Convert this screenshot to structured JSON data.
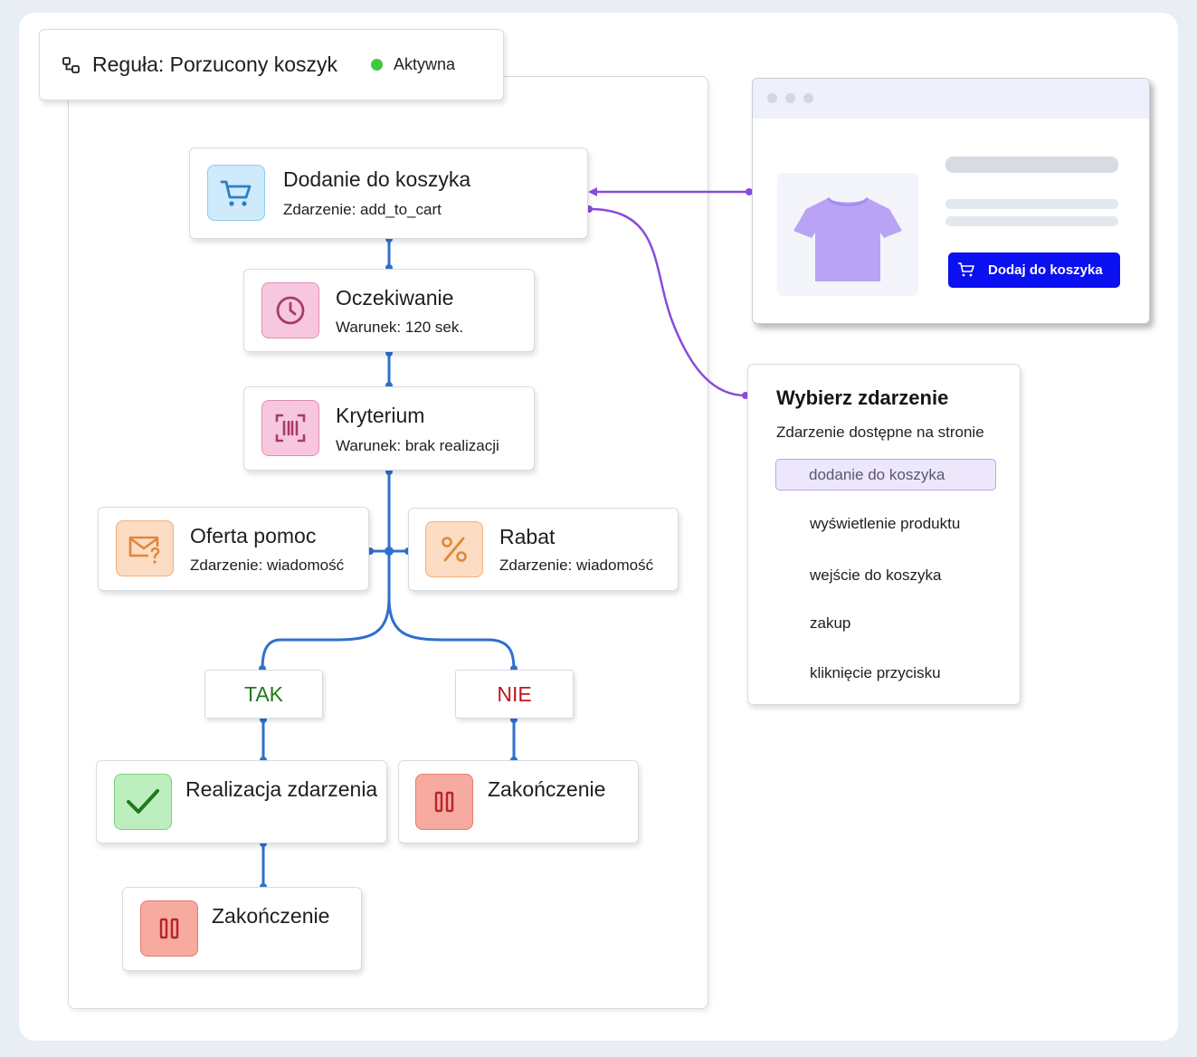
{
  "header": {
    "title": "Reguła: Porzucony koszyk",
    "status": "Aktywna",
    "status_color": "#3ec93e"
  },
  "nodes": {
    "add_to_cart": {
      "title": "Dodanie do koszyka",
      "subtitle": "Zdarzenie: add_to_cart",
      "icon": "cart-icon"
    },
    "wait": {
      "title": "Oczekiwanie",
      "subtitle": "Warunek: 120 sek.",
      "icon": "clock-icon"
    },
    "criterion": {
      "title": "Kryterium",
      "subtitle": "Warunek: brak realizacji",
      "icon": "scan-icon"
    },
    "offer_help": {
      "title": "Oferta pomoc",
      "subtitle": "Zdarzenie: wiadomość",
      "icon": "mail-question-icon"
    },
    "discount": {
      "title": "Rabat",
      "subtitle": "Zdarzenie: wiadomość",
      "icon": "percent-icon"
    },
    "yes_label": "TAK",
    "no_label": "NIE",
    "realization": {
      "title": "Realizacja zdarzenia",
      "icon": "check-icon"
    },
    "end_no": {
      "title": "Zakończenie",
      "icon": "pause-icon"
    },
    "end_yes": {
      "title": "Zakończenie",
      "icon": "pause-icon"
    }
  },
  "browser_preview": {
    "button_label": "Dodaj do koszyka",
    "button_color": "#0b10f0",
    "product_icon": "tshirt-icon"
  },
  "event_picker": {
    "title": "Wybierz zdarzenie",
    "subtitle": "Zdarzenie dostępne na stronie",
    "selected": "dodanie do koszyka",
    "options": [
      "wyświetlenie produktu",
      "wejście do koszyka",
      "zakup",
      "kliknięcie przycisku"
    ]
  },
  "colors": {
    "flow_line": "#2f6fcf",
    "connector": "#8a4bdc",
    "yes": "#1f7a1f",
    "no": "#c0161c"
  }
}
